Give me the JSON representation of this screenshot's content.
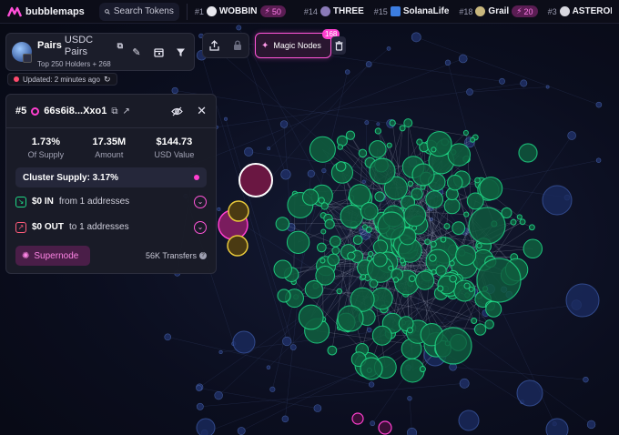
{
  "app": {
    "name": "bubblemaps"
  },
  "search": {
    "label": "Search Tokens"
  },
  "ticker": [
    {
      "rank": "#1",
      "name": "WOBBIN",
      "badge": "50",
      "avatar_color": "#e8e8ee"
    },
    {
      "rank": "#14",
      "name": "THREE",
      "badge": "",
      "avatar_color": "#8a7ab8"
    },
    {
      "rank": "#15",
      "name": "SolanaLife",
      "badge": "",
      "avatar_color": "#3c7de0"
    },
    {
      "rank": "#18",
      "name": "Grail",
      "badge": "20",
      "avatar_color": "#c9b77d"
    },
    {
      "rank": "#3",
      "name": "ASTEROID",
      "badge": "",
      "avatar_color": "#d8d8e0"
    }
  ],
  "token": {
    "name": "Pairs",
    "symbol": "USDC Pairs",
    "subtitle": "Top 250 Holders + 268"
  },
  "updated": {
    "text": "Updated: 2 minutes ago"
  },
  "magic_nodes": {
    "label": "Magic Nodes",
    "count": "168"
  },
  "detail": {
    "rank": "#5",
    "address": "66s6i8...Xxo1",
    "stats": [
      {
        "value": "1.73%",
        "label": "Of Supply"
      },
      {
        "value": "17.35M",
        "label": "Amount"
      },
      {
        "value": "$144.73",
        "label": "USD Value"
      }
    ],
    "cluster_supply": "Cluster Supply: 3.17%",
    "in": {
      "amount": "$0 IN",
      "desc": "from 1 addresses"
    },
    "out": {
      "amount": "$0 OUT",
      "desc": "to 1 addresses"
    },
    "supernode_label": "Supernode",
    "transfers": "56K Transfers"
  },
  "colors": {
    "accent": "#ff3fcf",
    "node_green": "#1fd986",
    "node_blue": "#1f2f66",
    "node_yellow": "#e9c93a",
    "selected": "#6a1742"
  }
}
